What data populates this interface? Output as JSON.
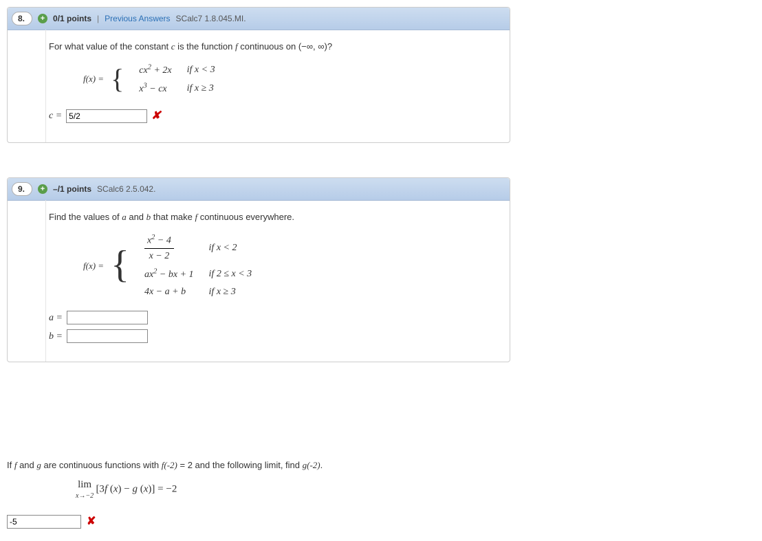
{
  "q8": {
    "number": "8.",
    "points": "0/1 points",
    "sep": "|",
    "prev_link": "Previous Answers",
    "refcode": "SCalc7 1.8.045.MI.",
    "prompt_a": "For what value of the constant ",
    "prompt_c": "c",
    "prompt_b": " is the function ",
    "prompt_f": "f",
    "prompt_d": " continuous on (−∞, ∞)?",
    "fx": "f(x) = ",
    "p1_expr": "cx² + 2x",
    "p1_cond": "if x < 3",
    "p2_expr": "x³ − cx",
    "p2_cond": "if x ≥ 3",
    "answer_label": "c = ",
    "answer_value": "5/2"
  },
  "q9": {
    "number": "9.",
    "points": "–/1 points",
    "refcode": "SCalc6 2.5.042.",
    "prompt_a": "Find the values of ",
    "prompt_ab": "a",
    "prompt_and": " and ",
    "prompt_bb": "b",
    "prompt_c": " that make ",
    "prompt_f": "f",
    "prompt_d": " continuous everywhere.",
    "fx": "f(x) = ",
    "p1_num": "x² − 4",
    "p1_den": "x − 2",
    "p1_cond": "if x < 2",
    "p2_expr": "ax² − bx + 1",
    "p2_cond": "if 2 ≤ x < 3",
    "p3_expr": "4x − a + b",
    "p3_cond": "if x ≥ 3",
    "a_label": "a = ",
    "b_label": "b = "
  },
  "extra": {
    "prompt_a": "If ",
    "prompt_f": "f",
    "prompt_b": " and ",
    "prompt_g": "g",
    "prompt_c": " are continuous functions with ",
    "prompt_fv": "f(-2)",
    "prompt_d": " = 2 and the following limit, find ",
    "prompt_gv": "g(-2)",
    "prompt_e": ".",
    "lim_pre": "lim",
    "lim_sub": "x→−2",
    "lim_body": "[3f (x) − g (x)] = −2",
    "answer_value": "-5"
  }
}
